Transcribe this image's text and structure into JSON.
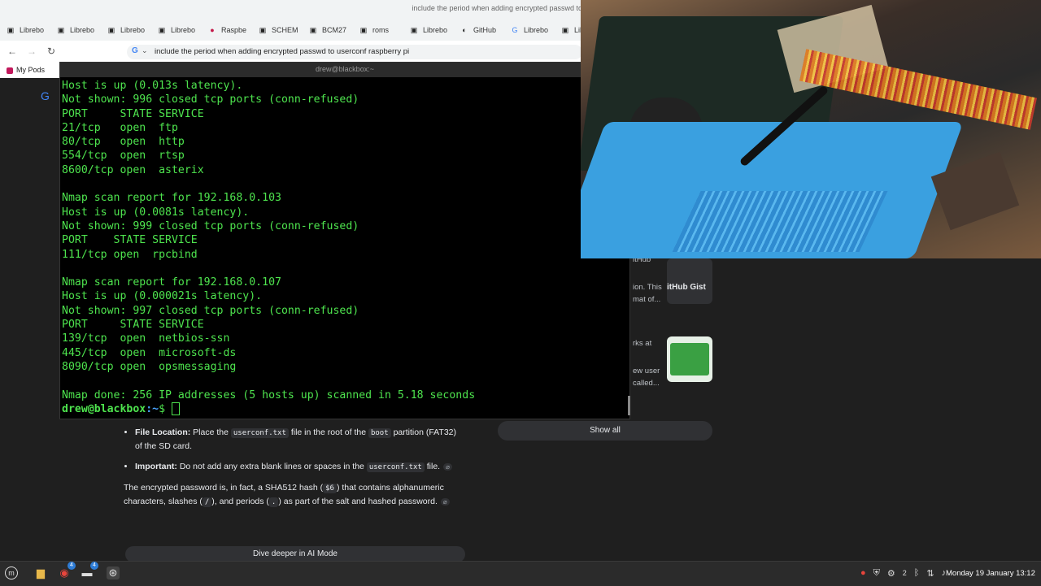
{
  "browser": {
    "window_title": "include the period when adding encrypted passwd to userconf raspberry",
    "tabs": [
      {
        "label": "Librebo",
        "icon": "libre-icon"
      },
      {
        "label": "Librebo",
        "icon": "libre-icon"
      },
      {
        "label": "Librebo",
        "icon": "libre-icon"
      },
      {
        "label": "Librebo",
        "icon": "libre-icon"
      },
      {
        "label": "Raspbe",
        "icon": "raspberry-icon"
      },
      {
        "label": "SCHEM",
        "icon": "doc-icon"
      },
      {
        "label": "BCM27",
        "icon": "doc-icon"
      },
      {
        "label": "roms",
        "icon": "doc-icon"
      },
      {
        "label": "Librebo",
        "icon": "libre-icon"
      },
      {
        "label": "GitHub",
        "icon": "github-icon"
      },
      {
        "label": "Librebo",
        "icon": "google-icon"
      },
      {
        "label": "Libre",
        "icon": "doc-icon"
      }
    ],
    "omnibox_text": "include the period when adding encrypted passwd to userconf raspberry pi",
    "bookmark": "My Pods"
  },
  "terminal": {
    "title": "drew@blackbox:~",
    "lines": [
      "Host is up (0.013s latency).",
      "Not shown: 996 closed tcp ports (conn-refused)",
      "PORT     STATE SERVICE",
      "21/tcp   open  ftp",
      "80/tcp   open  http",
      "554/tcp  open  rtsp",
      "8600/tcp open  asterix",
      "",
      "Nmap scan report for 192.168.0.103",
      "Host is up (0.0081s latency).",
      "Not shown: 999 closed tcp ports (conn-refused)",
      "PORT    STATE SERVICE",
      "111/tcp open  rpcbind",
      "",
      "Nmap scan report for 192.168.0.107",
      "Host is up (0.000021s latency).",
      "Not shown: 997 closed tcp ports (conn-refused)",
      "PORT     STATE SERVICE",
      "139/tcp  open  netbios-ssn",
      "445/tcp  open  microsoft-ds",
      "8090/tcp open  opsmessaging",
      "",
      "Nmap done: 256 IP addresses (5 hosts up) scanned in 5.18 seconds"
    ],
    "prompt_user": "drew@blackbox",
    "prompt_path": ":~",
    "prompt_symbol": "$ "
  },
  "results": {
    "snip1_top": "itHub",
    "snip1_a": "ion. This",
    "snip1_b": "mat of...",
    "gist_label": "itHub Gist",
    "snip2_a": "rks at",
    "snip2_b": "ew user",
    "snip2_c": "called...",
    "show_all": "Show all"
  },
  "ai_overview": {
    "item1_label": "File Location:",
    "item1_t1": " Place the ",
    "item1_code1": "userconf.txt",
    "item1_t2": " file in the root of the ",
    "item1_code2": "boot",
    "item1_t3": " partition (FAT32) of the SD card.",
    "item2_label": "Important:",
    "item2_t1": " Do not add any extra blank lines or spaces in the ",
    "item2_code1": "userconf.txt",
    "item2_t2": " file.",
    "para_t1": "The encrypted password is, in fact, a SHA512 hash (",
    "para_code1": "$6",
    "para_t2": ") that contains alphanumeric characters, slashes (",
    "para_code2": "/",
    "para_t3": "), and periods (",
    "para_code3": ".",
    "para_t4": ") as part of the salt and hashed password.",
    "dive_deeper": "Dive deeper in AI Mode"
  },
  "taskbar": {
    "badge1": "4",
    "badge2": "4",
    "tray_count": "2",
    "clock": "Monday 19 January 13:12"
  }
}
